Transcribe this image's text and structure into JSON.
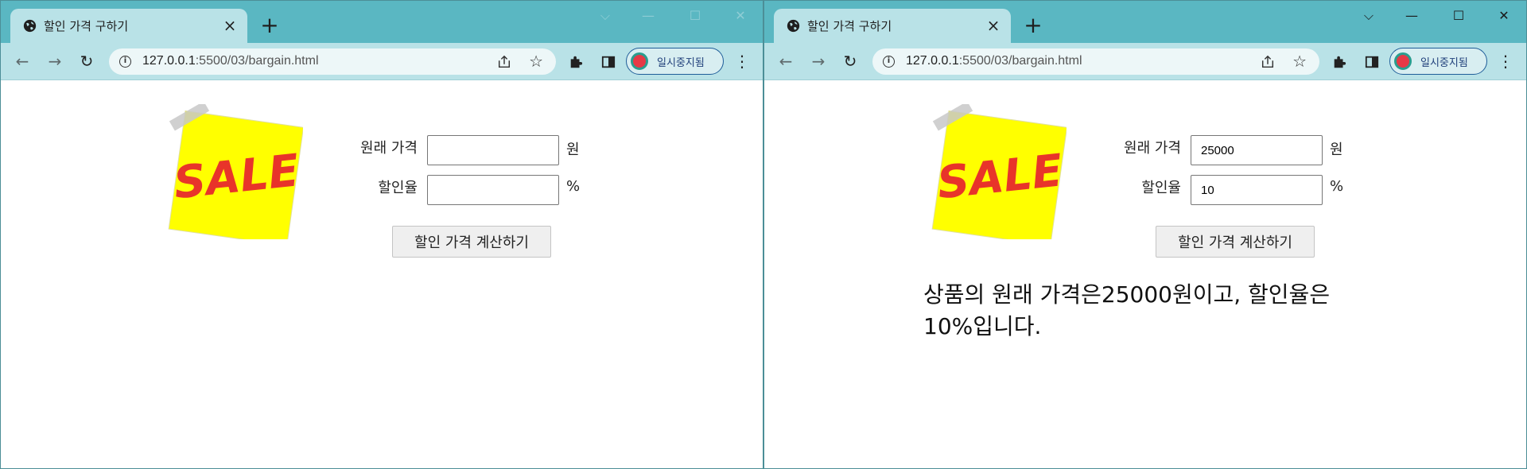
{
  "windows": [
    {
      "tab_title": "할인 가격 구하기",
      "url_host": "127.0.0.1",
      "url_rest": ":5500/03/bargain.html",
      "profile_status": "일시중지됨",
      "sale_text": "SALE",
      "form": {
        "price_label": "원래 가격",
        "price_value": "",
        "price_unit": "원",
        "rate_label": "할인율",
        "rate_value": "",
        "rate_unit": "%",
        "button_label": "할인 가격 계산하기"
      },
      "result": ""
    },
    {
      "tab_title": "할인 가격 구하기",
      "url_host": "127.0.0.1",
      "url_rest": ":5500/03/bargain.html",
      "profile_status": "일시중지됨",
      "sale_text": "SALE",
      "form": {
        "price_label": "원래 가격",
        "price_value": "25000",
        "price_unit": "원",
        "rate_label": "할인율",
        "rate_value": "10",
        "rate_unit": "%",
        "button_label": "할인 가격 계산하기"
      },
      "result": "상품의 원래 가격은25000원이고, 할인율은 10%입니다."
    }
  ],
  "colors": {
    "tabstrip": "#5ab7c2",
    "toolbar": "#b9e2e7",
    "sale_note": "#ffff00",
    "sale_text": "#e8342a"
  },
  "icons": [
    "globe-icon",
    "close-icon",
    "plus-icon",
    "back-icon",
    "forward-icon",
    "reload-icon",
    "info-icon",
    "share-icon",
    "star-icon",
    "puzzle-icon",
    "sidepanel-icon",
    "avatar",
    "menu-icon",
    "minimize-icon",
    "maximize-icon",
    "window-close-icon",
    "tab-search-icon"
  ]
}
